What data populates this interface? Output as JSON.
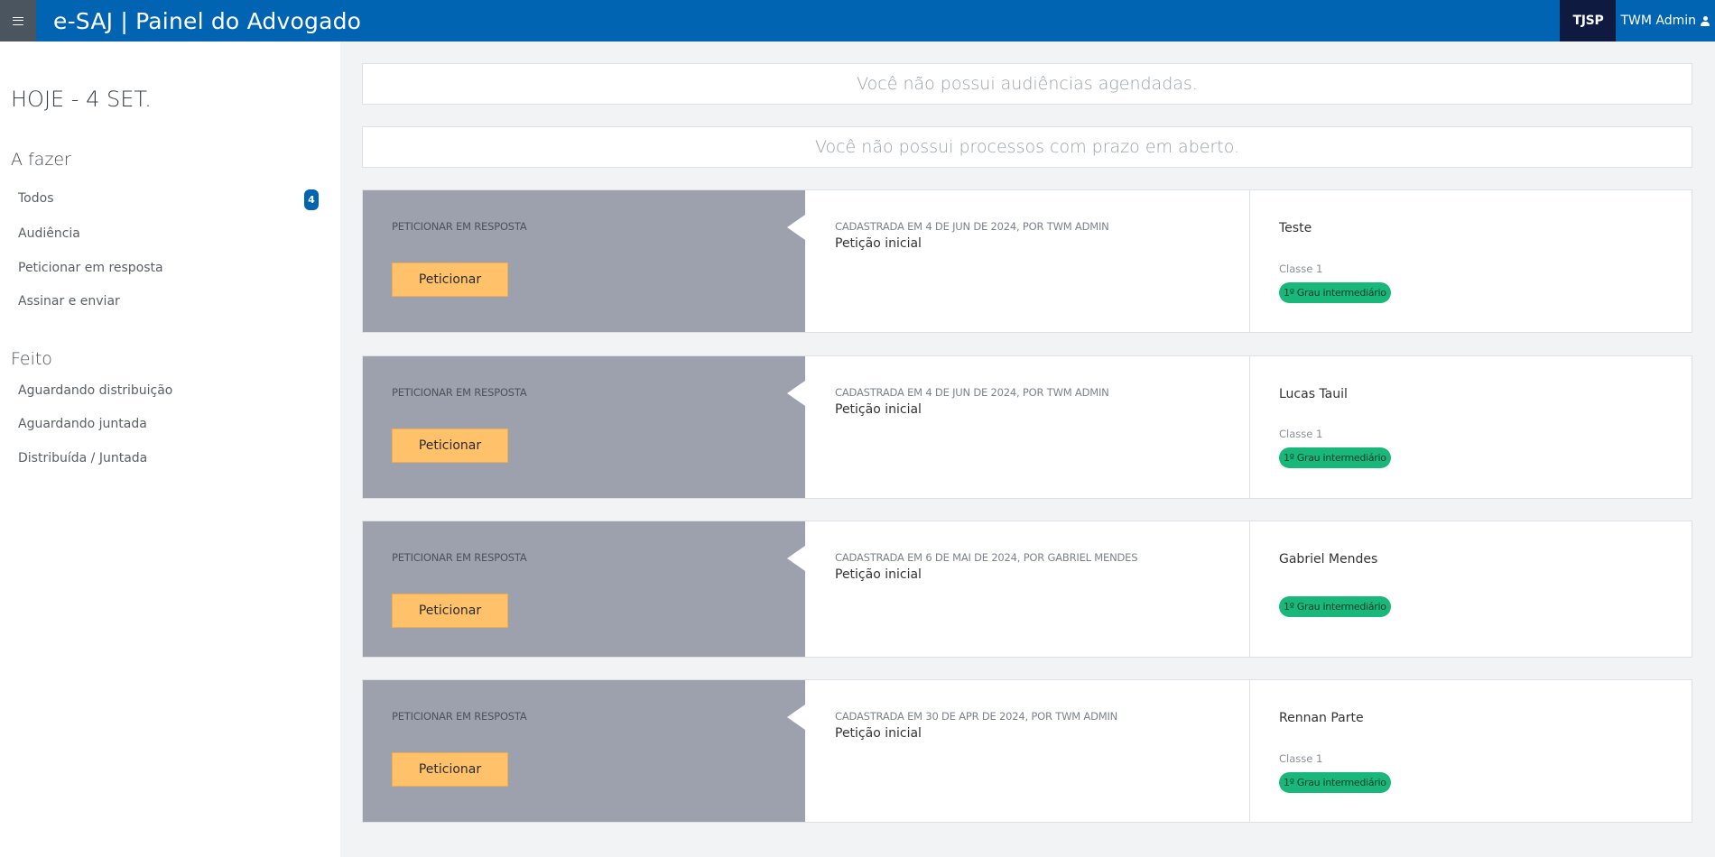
{
  "header": {
    "menu_icon": "hamburger-icon",
    "title": "e-SAJ | Painel do Advogado",
    "court": "TJSP",
    "user_name": "TWM Admin",
    "user_icon": "user-icon"
  },
  "sidebar": {
    "date": "HOJE - 4 SET.",
    "todo_heading": "A fazer",
    "todo_items": [
      {
        "label": "Todos",
        "badge": "4"
      },
      {
        "label": "Audiência"
      },
      {
        "label": "Peticionar em resposta"
      },
      {
        "label": "Assinar e enviar"
      }
    ],
    "done_heading": "Feito",
    "done_items": [
      {
        "label": "Aguardando distribuição"
      },
      {
        "label": "Aguardando juntada"
      },
      {
        "label": "Distribuída / Juntada"
      }
    ]
  },
  "notices": {
    "hearings": "Você não possui audiências agendadas.",
    "deadlines": "Você não possui processos com prazo em aberto."
  },
  "cards": [
    {
      "action_label": "PETICIONAR EM RESPOSTA",
      "button_label": "Peticionar",
      "meta": "CADASTRADA EM 4 DE JUN DE 2024, POR TWM ADMIN",
      "doc_title": "Petição inicial",
      "party": "Teste",
      "class_label": "Classe 1",
      "tag": "1º Grau intermediário"
    },
    {
      "action_label": "PETICIONAR EM RESPOSTA",
      "button_label": "Peticionar",
      "meta": "CADASTRADA EM 4 DE JUN DE 2024, POR TWM ADMIN",
      "doc_title": "Petição inicial",
      "party": "Lucas Tauil",
      "class_label": "Classe 1",
      "tag": "1º Grau intermediário"
    },
    {
      "action_label": "PETICIONAR EM RESPOSTA",
      "button_label": "Peticionar",
      "meta": "CADASTRADA EM 6 DE MAI DE 2024, POR GABRIEL MENDES",
      "doc_title": "Petição inicial",
      "party": "Gabriel Mendes",
      "tag": "1º Grau intermediário"
    },
    {
      "action_label": "PETICIONAR EM RESPOSTA",
      "button_label": "Peticionar",
      "meta": "CADASTRADA EM 30 DE APR DE 2024, POR TWM ADMIN",
      "doc_title": "Petição inicial",
      "party": "Rennan Parte",
      "class_label": "Classe 1",
      "tag": "1º Grau intermediário"
    }
  ],
  "colors": {
    "brand": "#0064b3",
    "action_panel": "#9ca1ad",
    "button": "#ffc26b",
    "tag": "#19b77a"
  }
}
